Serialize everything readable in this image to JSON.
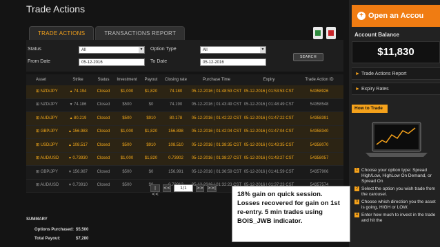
{
  "page": {
    "title": "Trade Actions"
  },
  "tabs": [
    {
      "label": "TRADE ACTIONS",
      "active": true
    },
    {
      "label": "TRANSACTIONS REPORT",
      "active": false
    }
  ],
  "toolbar": {
    "excel_icon": "excel-export-icon",
    "pdf_icon": "pdf-export-icon"
  },
  "filters": {
    "status_label": "Status",
    "status_value": "All",
    "option_type_label": "Option Type",
    "option_type_value": "All",
    "from_date_label": "From Date",
    "from_date_value": "05-12-2016",
    "to_date_label": "To Date",
    "to_date_value": "05-12-2016",
    "search_label": "SEARCH"
  },
  "table": {
    "headers": [
      "Asset",
      "Strike",
      "Status",
      "Investment",
      "Payout",
      "Closing rate",
      "Purchase Time",
      "Expiry",
      "Trade Action ID"
    ],
    "rows": [
      {
        "asset": "NZD/JPY",
        "direction": "up",
        "strike": "74.194",
        "status": "Closed",
        "investment": "$1,000",
        "payout": "$1,820",
        "closing": "74.180",
        "purchase_time": "05-12-2016 | 01:48:53 CST",
        "expiry": "05-12-2016 | 01:53:53 CST",
        "id": "54358926",
        "won": true
      },
      {
        "asset": "NZD/JPY",
        "direction": "down",
        "strike": "74.186",
        "status": "Closed",
        "investment": "$500",
        "payout": "$0",
        "closing": "74.190",
        "purchase_time": "05-12-2016 | 01:43:49 CST",
        "expiry": "05-12-2016 | 01:48:49 CST",
        "id": "54358548",
        "won": false
      },
      {
        "asset": "AUD/JPY",
        "direction": "up",
        "strike": "80.219",
        "status": "Closed",
        "investment": "$500",
        "payout": "$910",
        "closing": "80.178",
        "purchase_time": "05-12-2016 | 01:42:22 CST",
        "expiry": "05-12-2016 | 01:47:22 CST",
        "id": "54358391",
        "won": true
      },
      {
        "asset": "GBP/JPY",
        "direction": "up",
        "strike": "156.983",
        "status": "Closed",
        "investment": "$1,000",
        "payout": "$1,820",
        "closing": "156.898",
        "purchase_time": "05-12-2016 | 01:42:04 CST",
        "expiry": "05-12-2016 | 01:47:04 CST",
        "id": "54358340",
        "won": true
      },
      {
        "asset": "USD/JPY",
        "direction": "up",
        "strike": "108.517",
        "status": "Closed",
        "investment": "$500",
        "payout": "$910",
        "closing": "108.510",
        "purchase_time": "05-12-2016 | 01:38:35 CST",
        "expiry": "05-12-2016 | 01:43:35 CST",
        "id": "54358070",
        "won": true
      },
      {
        "asset": "AUD/USD",
        "direction": "down",
        "strike": "0.73930",
        "status": "Closed",
        "investment": "$1,000",
        "payout": "$1,820",
        "closing": "0.73902",
        "purchase_time": "05-12-2016 | 01:38:27 CST",
        "expiry": "05-12-2016 | 01:43:27 CST",
        "id": "54358057",
        "won": true
      },
      {
        "asset": "GBP/JPY",
        "direction": "down",
        "strike": "156.987",
        "status": "Closed",
        "investment": "$500",
        "payout": "$0",
        "closing": "156.991",
        "purchase_time": "05-12-2016 | 01:36:59 CST",
        "expiry": "05-12-2016 | 01:41:59 CST",
        "id": "54357906",
        "won": false
      },
      {
        "asset": "AUD/USD",
        "direction": "down",
        "strike": "0.73910",
        "status": "Closed",
        "investment": "$500",
        "payout": "$0",
        "closing": "0.73912",
        "purchase_time": "05-12-2016 | 01:32:23 CST",
        "expiry": "05-12-2016 | 01:37:23 CST",
        "id": "54357574",
        "won": false
      }
    ]
  },
  "pagination": {
    "first": "|<<",
    "prev": "<<",
    "page": "1/1",
    "next": ">>",
    "last": ">>|"
  },
  "summary": {
    "title": "SUMMARY",
    "purchased_label": "Options Purchased:",
    "purchased_value": "$5,500",
    "payout_label": "Total Payout:",
    "payout_value": "$7,280"
  },
  "annotation": {
    "text": "18% gain on quick session. Losses recovered for gain on 1st re-entry. 5 min trades using BOIS_JWB indicator."
  },
  "sidebar": {
    "open_account_label": "Open an Accou",
    "balance_label": "Account Balance",
    "balance_value": "$11,830",
    "links": [
      "Trade Actions Report",
      "Expiry Rates"
    ],
    "howto_label": "How to Trade",
    "steps": [
      {
        "num": "1",
        "text": "Choose your option type: Spread High/Low, HighLow On Demand, or Spread On"
      },
      {
        "num": "2",
        "text": "Select the option you wish trade from the carousel."
      },
      {
        "num": "3",
        "text": "Choose which direction you the asset is going, HIGH or LOW."
      },
      {
        "num": "4",
        "text": "Enter how much to invest in the trade and hit the"
      }
    ]
  },
  "colors": {
    "accent": "#f5a21b",
    "cta": "#f07c12",
    "background": "#141414"
  }
}
